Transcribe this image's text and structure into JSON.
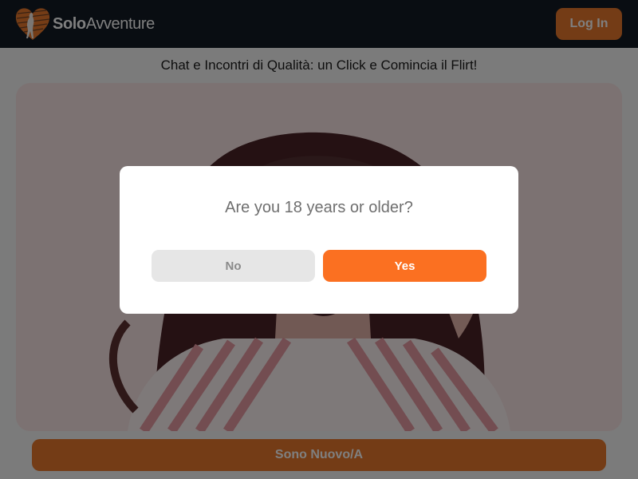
{
  "header": {
    "logo_icon": "heart-silhouette-logo",
    "logo_text_bold": "Solo",
    "logo_text_regular": "Avventure",
    "login_label": "Log In"
  },
  "tagline": "Chat e Incontri di Qualità: un Click e Comincia il Flirt!",
  "signup": {
    "label": "Sono Nuovo/A"
  },
  "age_modal": {
    "question": "Are you 18 years or older?",
    "no_label": "No",
    "yes_label": "Yes"
  },
  "colors": {
    "header_bg": "#121a24",
    "accent": "#fb7021",
    "button_orange": "#e8782c",
    "overlay": "rgba(0,0,0,0.5)"
  }
}
